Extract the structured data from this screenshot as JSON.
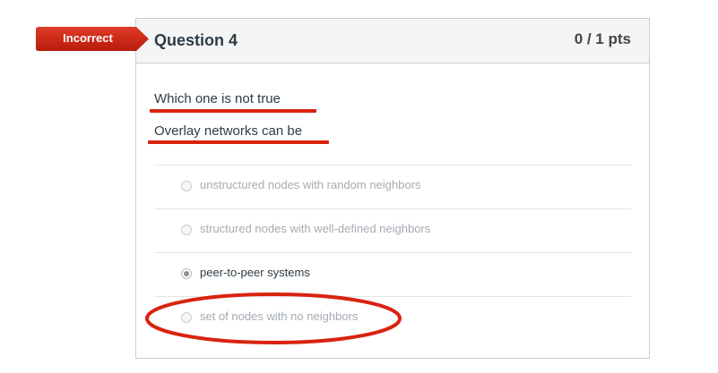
{
  "badge": {
    "label": "Incorrect",
    "color": "#d9230f"
  },
  "question": {
    "title": "Question 4",
    "points": "0 / 1 pts",
    "prompt_line_1": "Which one is not true",
    "prompt_line_2": "Overlay networks can be"
  },
  "answers": [
    {
      "label": "unstructured nodes with random neighbors",
      "selected": false
    },
    {
      "label": "structured nodes with well-defined neighbors",
      "selected": false
    },
    {
      "label": "peer-to-peer systems",
      "selected": true
    },
    {
      "label": "set of nodes with no neighbors",
      "selected": false
    }
  ],
  "annotations": {
    "mark_color": "#d9230f",
    "circled_answer": "set of nodes with no neighbors"
  }
}
